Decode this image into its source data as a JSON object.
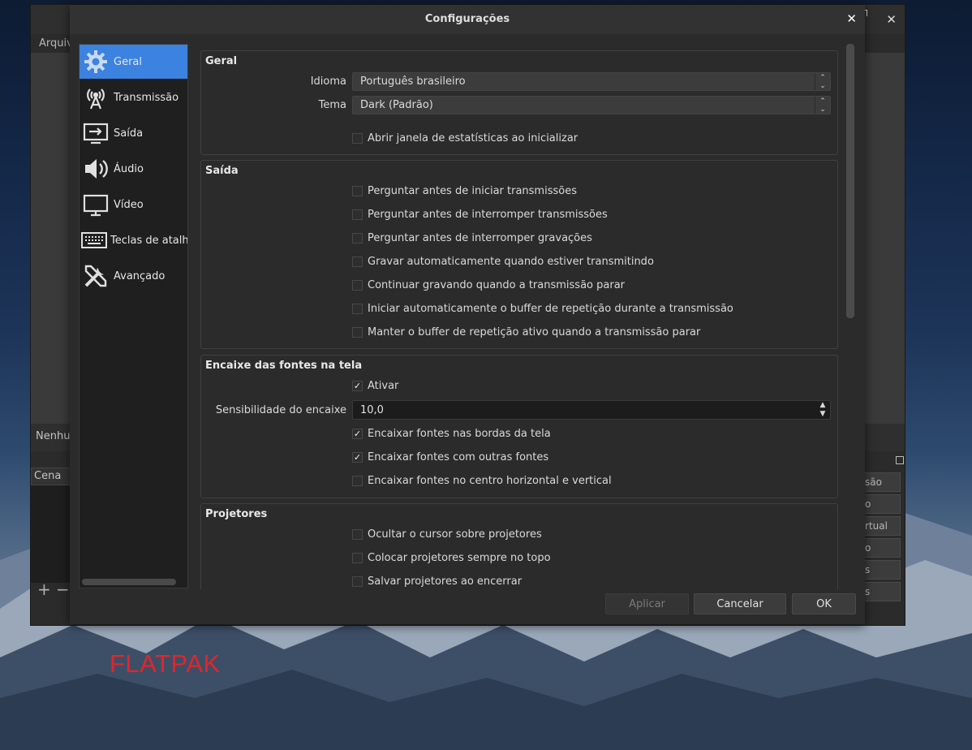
{
  "background_window": {
    "menu_first": "Arquiv",
    "no_source": "Nenhur",
    "scene_header": "Cena",
    "control_buttons": [
      "são",
      "o",
      "rtual",
      "o",
      "s",
      "s"
    ]
  },
  "watermark": "FLATPAK",
  "dialog": {
    "title": "Configurações",
    "close_glyph": "✕"
  },
  "sidebar": {
    "items": [
      {
        "label": "Geral",
        "icon": "gear-icon",
        "active": true
      },
      {
        "label": "Transmissão",
        "icon": "antenna-icon",
        "active": false
      },
      {
        "label": "Saída",
        "icon": "output-icon",
        "active": false
      },
      {
        "label": "Áudio",
        "icon": "speaker-icon",
        "active": false
      },
      {
        "label": "Vídeo",
        "icon": "monitor-icon",
        "active": false
      },
      {
        "label": "Teclas de atalho",
        "icon": "keyboard-icon",
        "active": false
      },
      {
        "label": "Avançado",
        "icon": "tools-icon",
        "active": false
      }
    ]
  },
  "sections": {
    "geral": {
      "title": "Geral",
      "language_label": "Idioma",
      "language_value": "Português brasileiro",
      "theme_label": "Tema",
      "theme_value": "Dark (Padrão)",
      "stats_checkbox": {
        "label": "Abrir janela de estatísticas ao inicializar",
        "checked": false
      }
    },
    "saida": {
      "title": "Saída",
      "options": [
        {
          "label": "Perguntar antes de iniciar transmissões",
          "checked": false
        },
        {
          "label": "Perguntar antes de interromper transmissões",
          "checked": false
        },
        {
          "label": "Perguntar antes de interromper gravações",
          "checked": false
        },
        {
          "label": "Gravar automaticamente quando estiver transmitindo",
          "checked": false
        },
        {
          "label": "Continuar gravando quando a transmissão parar",
          "checked": false
        },
        {
          "label": "Iniciar automaticamente o buffer de repetição durante a transmissão",
          "checked": false
        },
        {
          "label": "Manter o buffer de repetição ativo quando a transmissão parar",
          "checked": false
        }
      ]
    },
    "encaixe": {
      "title": "Encaixe das fontes na tela",
      "enable": {
        "label": "Ativar",
        "checked": true
      },
      "sensitivity_label": "Sensibilidade do encaixe",
      "sensitivity_value": "10,0",
      "options": [
        {
          "label": "Encaixar fontes nas bordas da tela",
          "checked": true
        },
        {
          "label": "Encaixar fontes com outras fontes",
          "checked": true
        },
        {
          "label": "Encaixar fontes no centro horizontal e vertical",
          "checked": false
        }
      ]
    },
    "projetores": {
      "title": "Projetores",
      "options": [
        {
          "label": "Ocultar o cursor sobre projetores",
          "checked": false
        },
        {
          "label": "Colocar projetores sempre no topo",
          "checked": false
        },
        {
          "label": "Salvar projetores ao encerrar",
          "checked": false
        }
      ]
    }
  },
  "footer": {
    "apply": "Aplicar",
    "cancel": "Cancelar",
    "ok": "OK"
  },
  "colors": {
    "accent": "#3c82e0",
    "dialog_bg": "#2b2b2b",
    "watermark": "#e3242b"
  }
}
